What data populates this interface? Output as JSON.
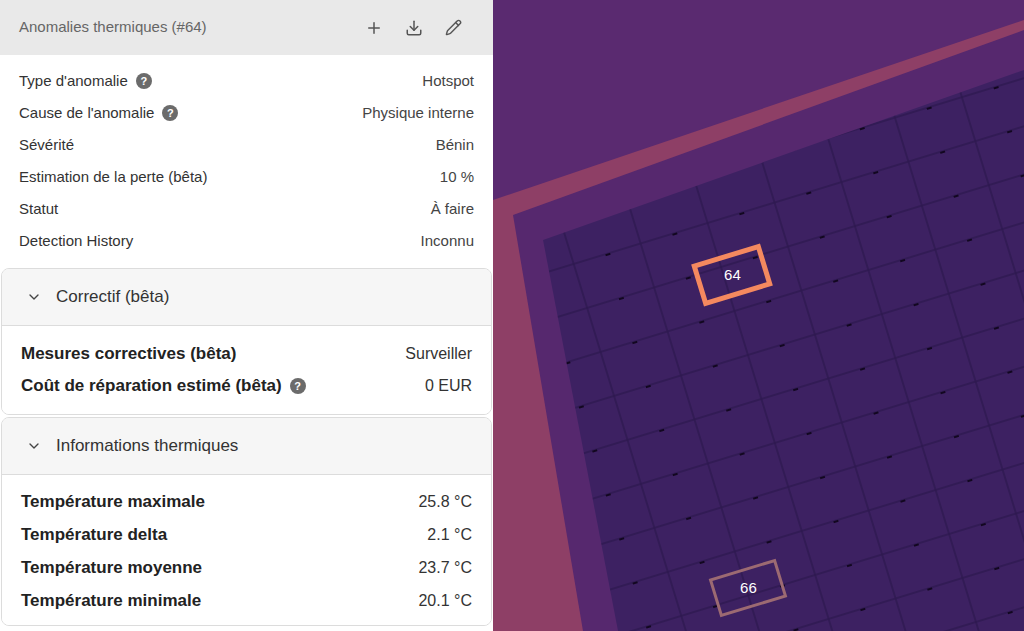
{
  "panel": {
    "title": "Anomalies thermiques (#64)"
  },
  "properties": [
    {
      "label": "Type d'anomalie",
      "hint": "?",
      "value": "Hotspot"
    },
    {
      "label": "Cause de l'anomalie",
      "hint": "?",
      "value": "Physique interne"
    },
    {
      "label": "Sévérité",
      "hint": "",
      "value": "Bénin"
    },
    {
      "label": "Estimation de la perte (bêta)",
      "hint": "",
      "value": "10 %"
    },
    {
      "label": "Statut",
      "hint": "",
      "value": "À faire"
    },
    {
      "label": "Detection History",
      "hint": "",
      "value": "Inconnu"
    }
  ],
  "sections": [
    {
      "title": "Correctif (bêta)",
      "expanded": true,
      "rows": [
        {
          "label": "Mesures correctives (bêta)",
          "hint": "",
          "value": "Surveiller"
        },
        {
          "label": "Coût de réparation estimé (bêta)",
          "hint": "?",
          "value": "0 EUR"
        }
      ]
    },
    {
      "title": "Informations thermiques",
      "expanded": true,
      "rows": [
        {
          "label": "Température maximale",
          "hint": "",
          "value": "25.8 °C"
        },
        {
          "label": "Température delta",
          "hint": "",
          "value": "2.1 °C"
        },
        {
          "label": "Température moyenne",
          "hint": "",
          "value": "23.7 °C"
        },
        {
          "label": "Température minimale",
          "hint": "",
          "value": "20.1 °C"
        }
      ]
    }
  ],
  "map": {
    "annotations": [
      {
        "label": "64",
        "selected": true,
        "color": "#f4895f"
      },
      {
        "label": "66",
        "selected": false,
        "color": "#9c6a72"
      }
    ]
  }
}
